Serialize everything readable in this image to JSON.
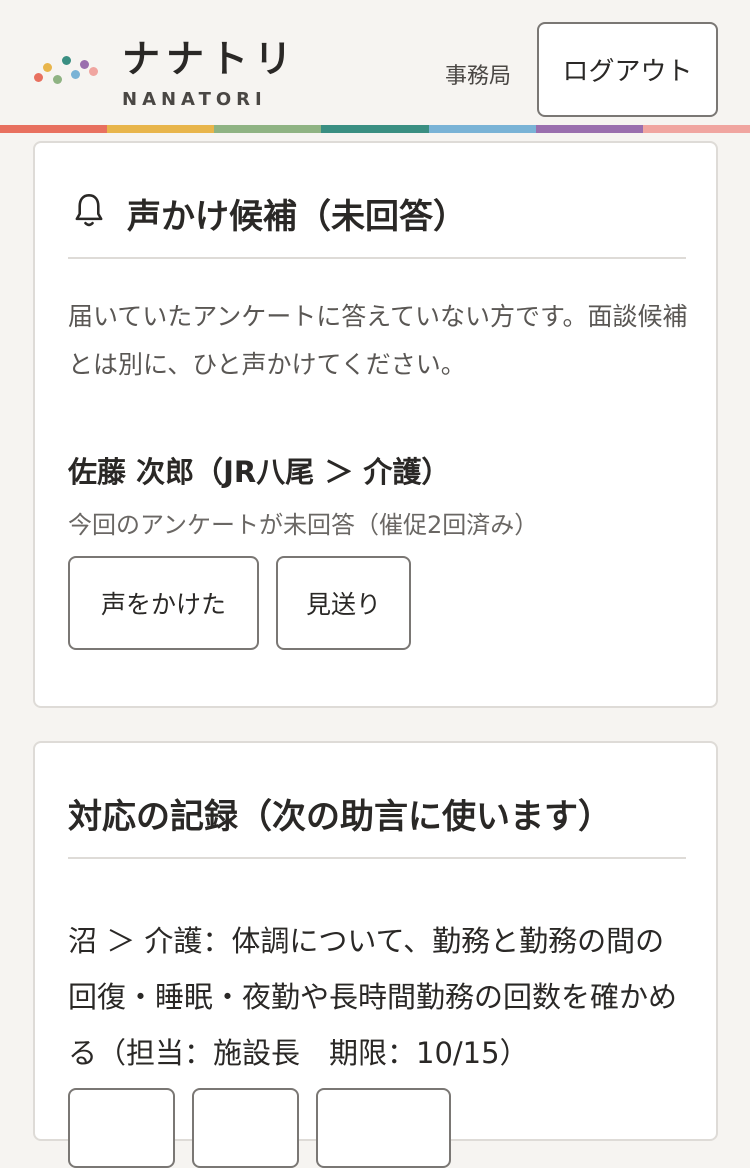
{
  "header": {
    "brand_name": "ナナトリ",
    "brand_sub": "NANATORI",
    "role_label": "事務局",
    "logout_label": "ログアウト",
    "logo_colors": [
      "#e8705f",
      "#e8b54b",
      "#8fb383",
      "#3a8f82",
      "#7ab3d6",
      "#9a6fae",
      "#f0a5a0"
    ]
  },
  "rainbow_colors": [
    "#e8705f",
    "#e8b54b",
    "#8fb383",
    "#3a8f82",
    "#7ab3d6",
    "#9a6fae",
    "#f0a5a0"
  ],
  "unanswered_card": {
    "icon": "bell-icon",
    "title": "声かけ候補（未回答）",
    "description": "届いていたアンケートに答えていない方です。面談候補とは別に、ひと声かけてください。",
    "person": {
      "name": "佐藤 次郎（JR八尾 ＞ 介護）",
      "note": "今回のアンケートが未回答（催促2回済み）"
    },
    "buttons": {
      "called": "声をかけた",
      "skip": "見送り"
    }
  },
  "record_card": {
    "title": "対応の記録（次の助言に使います）",
    "entry": "沼 ＞ 介護：体調について、勤務と勤務の間の回復・睡眠・夜勤や長時間勤務の回数を確かめる（担当：施設長　期限：10/15）"
  }
}
